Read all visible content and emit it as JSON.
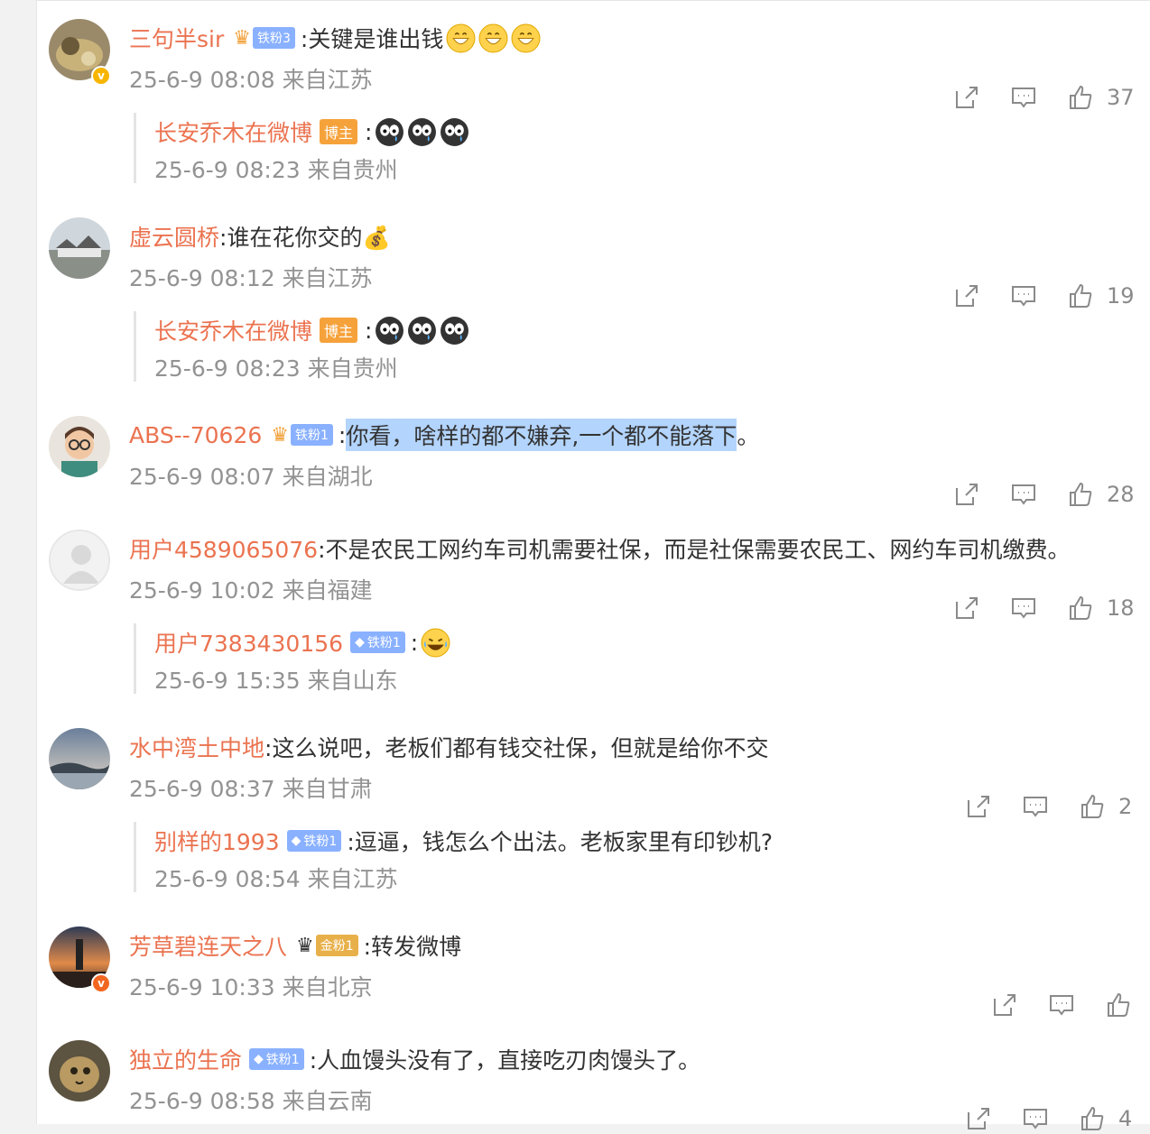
{
  "colors": {
    "username": "#eb7350",
    "meta": "#939393",
    "text": "#333333",
    "highlight": "#b3d4fc"
  },
  "comments": [
    {
      "name": "三句半sir",
      "badge": "铁粉3",
      "text": ":关键是谁出钱",
      "meta": "25-6-9 08:08 来自江苏",
      "likes": "37",
      "reply": {
        "name": "长安乔木在微博",
        "host": "博主",
        "text": ":",
        "meta": "25-6-9 08:23 来自贵州"
      }
    },
    {
      "name": "虚云圆桥",
      "text": ":谁在花你交的💰",
      "meta": "25-6-9 08:12 来自江苏",
      "likes": "19",
      "reply": {
        "name": "长安乔木在微博",
        "host": "博主",
        "text": ":",
        "meta": "25-6-9 08:23 来自贵州"
      }
    },
    {
      "name": "ABS--70626",
      "badge": "铁粉1",
      "text_pre": ":",
      "text_hl": "你看，啥样的都不嫌弃,一个都不能落下",
      "text_post": "。",
      "meta": "25-6-9 08:07 来自湖北",
      "likes": "28"
    },
    {
      "name": "用户4589065076",
      "text": ":不是农民工网约车司机需要社保，而是社保需要农民工、网约车司机缴费。",
      "meta": "25-6-9 10:02 来自福建",
      "likes": "18",
      "reply": {
        "name": "用户7383430156",
        "badge": "铁粉1",
        "text": ":",
        "meta": "25-6-9 15:35 来自山东"
      }
    },
    {
      "name": "水中湾土中地",
      "text": ":这么说吧，老板们都有钱交社保，但就是给你不交",
      "meta": "25-6-9 08:37 来自甘肃",
      "likes": "2",
      "reply": {
        "name": "别样的1993",
        "badge": "铁粉1",
        "text": ":逗逼，钱怎么个出法。老板家里有印钞机?",
        "meta": "25-6-9 08:54 来自江苏"
      }
    },
    {
      "name": "芳草碧连天之八",
      "badge": "金粉1",
      "text": ":转发微博",
      "meta": "25-6-9 10:33 来自北京",
      "likes": ""
    },
    {
      "name": "独立的生命",
      "badge": "铁粉1",
      "text": ":人血馒头没有了，直接吃刃肉馒头了。",
      "meta": "25-6-9 08:58 来自云南",
      "likes": "4"
    }
  ],
  "icons": {
    "share": "share-icon",
    "comment": "comment-icon",
    "like": "like-icon",
    "verified": "verified-icon"
  }
}
